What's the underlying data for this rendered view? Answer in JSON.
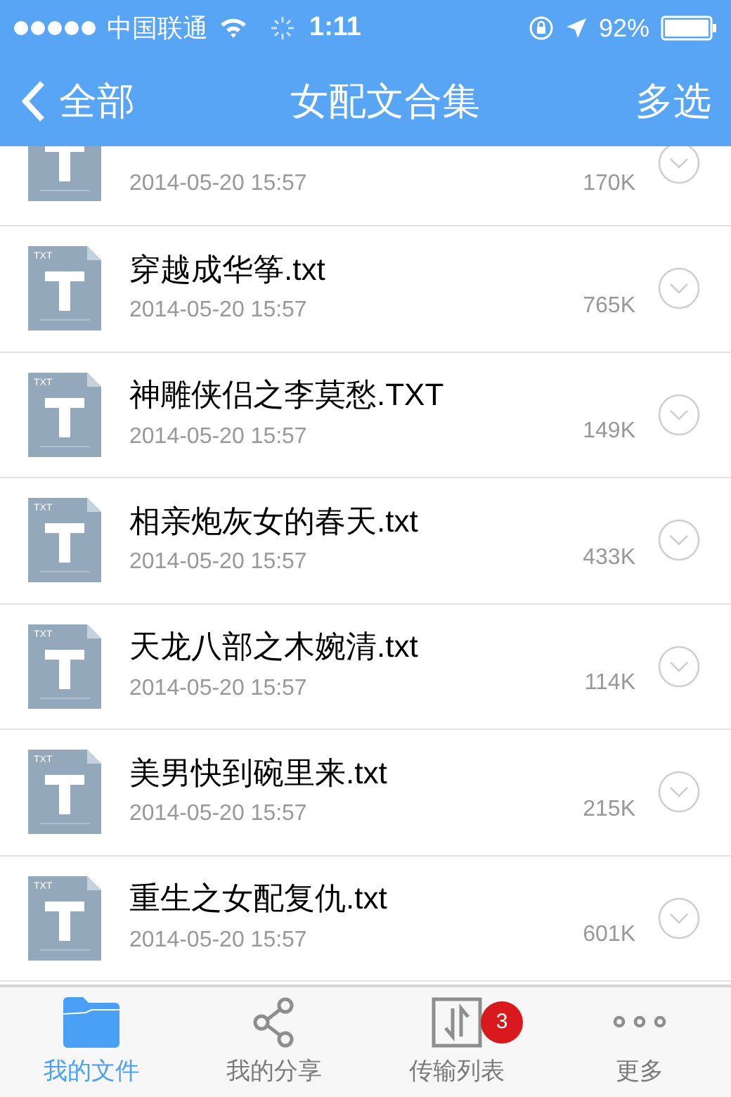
{
  "status_bar": {
    "carrier": "中国联通",
    "time": "1:11",
    "battery": "92%"
  },
  "nav": {
    "back": "全部",
    "title": "女配文合集",
    "action": "多选"
  },
  "files": [
    {
      "kind": "partial",
      "date": "2014-05-20 15:57",
      "size": "170K"
    },
    {
      "kind": "full",
      "badge": "TXT",
      "name": "穿越成华筝.txt",
      "date": "2014-05-20 15:57",
      "size": "765K"
    },
    {
      "kind": "full",
      "badge": "TXT",
      "name": "神雕侠侣之李莫愁.TXT",
      "date": "2014-05-20 15:57",
      "size": "149K"
    },
    {
      "kind": "full",
      "badge": "TXT",
      "name": "相亲炮灰女的春天.txt",
      "date": "2014-05-20 15:57",
      "size": "433K"
    },
    {
      "kind": "full",
      "badge": "TXT",
      "name": "天龙八部之木婉清.txt",
      "date": "2014-05-20 15:57",
      "size": "114K"
    },
    {
      "kind": "full",
      "badge": "TXT",
      "name": "美男快到碗里来.txt",
      "date": "2014-05-20 15:57",
      "size": "215K"
    },
    {
      "kind": "full",
      "badge": "TXT",
      "name": "重生之女配复仇.txt",
      "date": "2014-05-20 15:57",
      "size": "601K"
    }
  ],
  "tabs": [
    {
      "label": "我的文件",
      "kind": "folder",
      "selected": true
    },
    {
      "label": "我的分享",
      "kind": "share",
      "selected": false
    },
    {
      "label": "传输列表",
      "kind": "transfer",
      "selected": false,
      "badge": "3"
    },
    {
      "label": "更多",
      "kind": "more",
      "selected": false
    }
  ]
}
